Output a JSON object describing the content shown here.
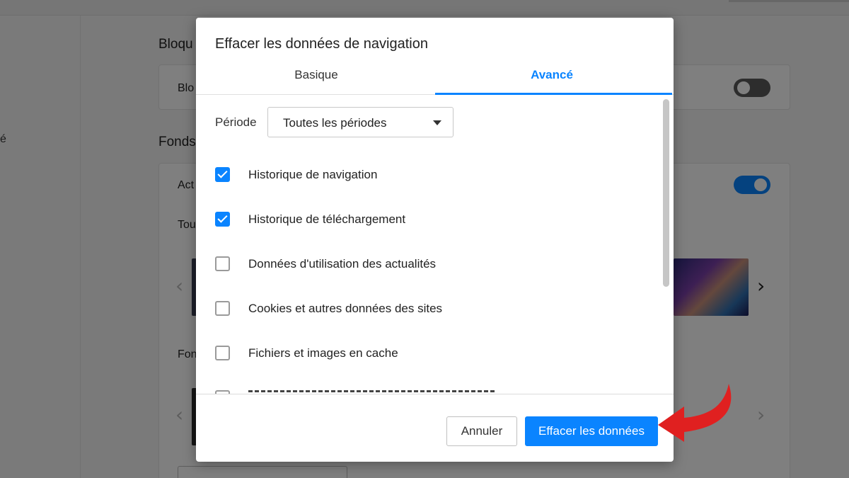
{
  "background": {
    "sidebar_fragment": "é",
    "sections": [
      {
        "heading": "Bloqu",
        "rows": [
          {
            "label": "Blo",
            "toggle": "off"
          }
        ]
      },
      {
        "heading": "Fonds",
        "rows": [
          {
            "label": "Act",
            "toggle": "on"
          },
          {
            "label": "Tou"
          },
          {
            "label": "Fon"
          }
        ]
      }
    ]
  },
  "dialog": {
    "title": "Effacer les données de navigation",
    "tabs": [
      {
        "label": "Basique",
        "active": false
      },
      {
        "label": "Avancé",
        "active": true
      }
    ],
    "period": {
      "label": "Période",
      "value": "Toutes les périodes"
    },
    "options": [
      {
        "label": "Historique de navigation",
        "checked": true
      },
      {
        "label": "Historique de téléchargement",
        "checked": true
      },
      {
        "label": "Données d'utilisation des actualités",
        "checked": false
      },
      {
        "label": "Cookies et autres données des sites",
        "checked": false
      },
      {
        "label": "Fichiers et images en cache",
        "checked": false
      }
    ],
    "buttons": {
      "cancel": "Annuler",
      "confirm": "Effacer les données"
    }
  },
  "colors": {
    "accent": "#0a84ff",
    "annotation_arrow": "#e02020"
  }
}
